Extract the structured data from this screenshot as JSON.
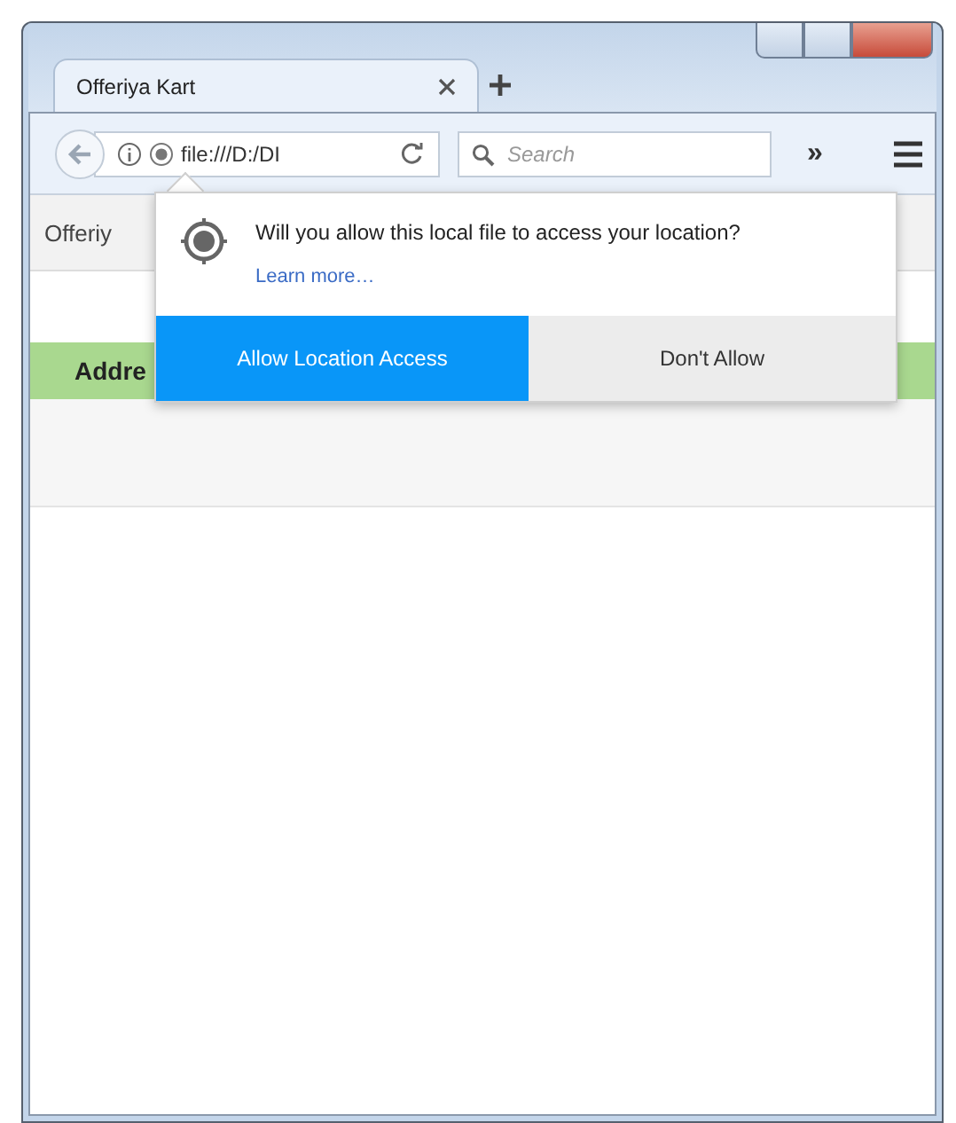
{
  "tabs": [
    {
      "label": "Offeriya Kart",
      "selected": true
    }
  ],
  "toolbar": {
    "url": "file:///D:/DI",
    "search": {
      "placeholder": "Search"
    },
    "overflow_button": "»"
  },
  "page": {
    "header": "Offeriy",
    "section_title": "Addre"
  },
  "location_prompt": {
    "message": "Will you allow this local file to access your location?",
    "link": "Learn more…",
    "buttons": [
      {
        "label": "Allow Location Access",
        "kind": "primary"
      },
      {
        "label": "Don't Allow",
        "kind": "secondary"
      }
    ]
  }
}
